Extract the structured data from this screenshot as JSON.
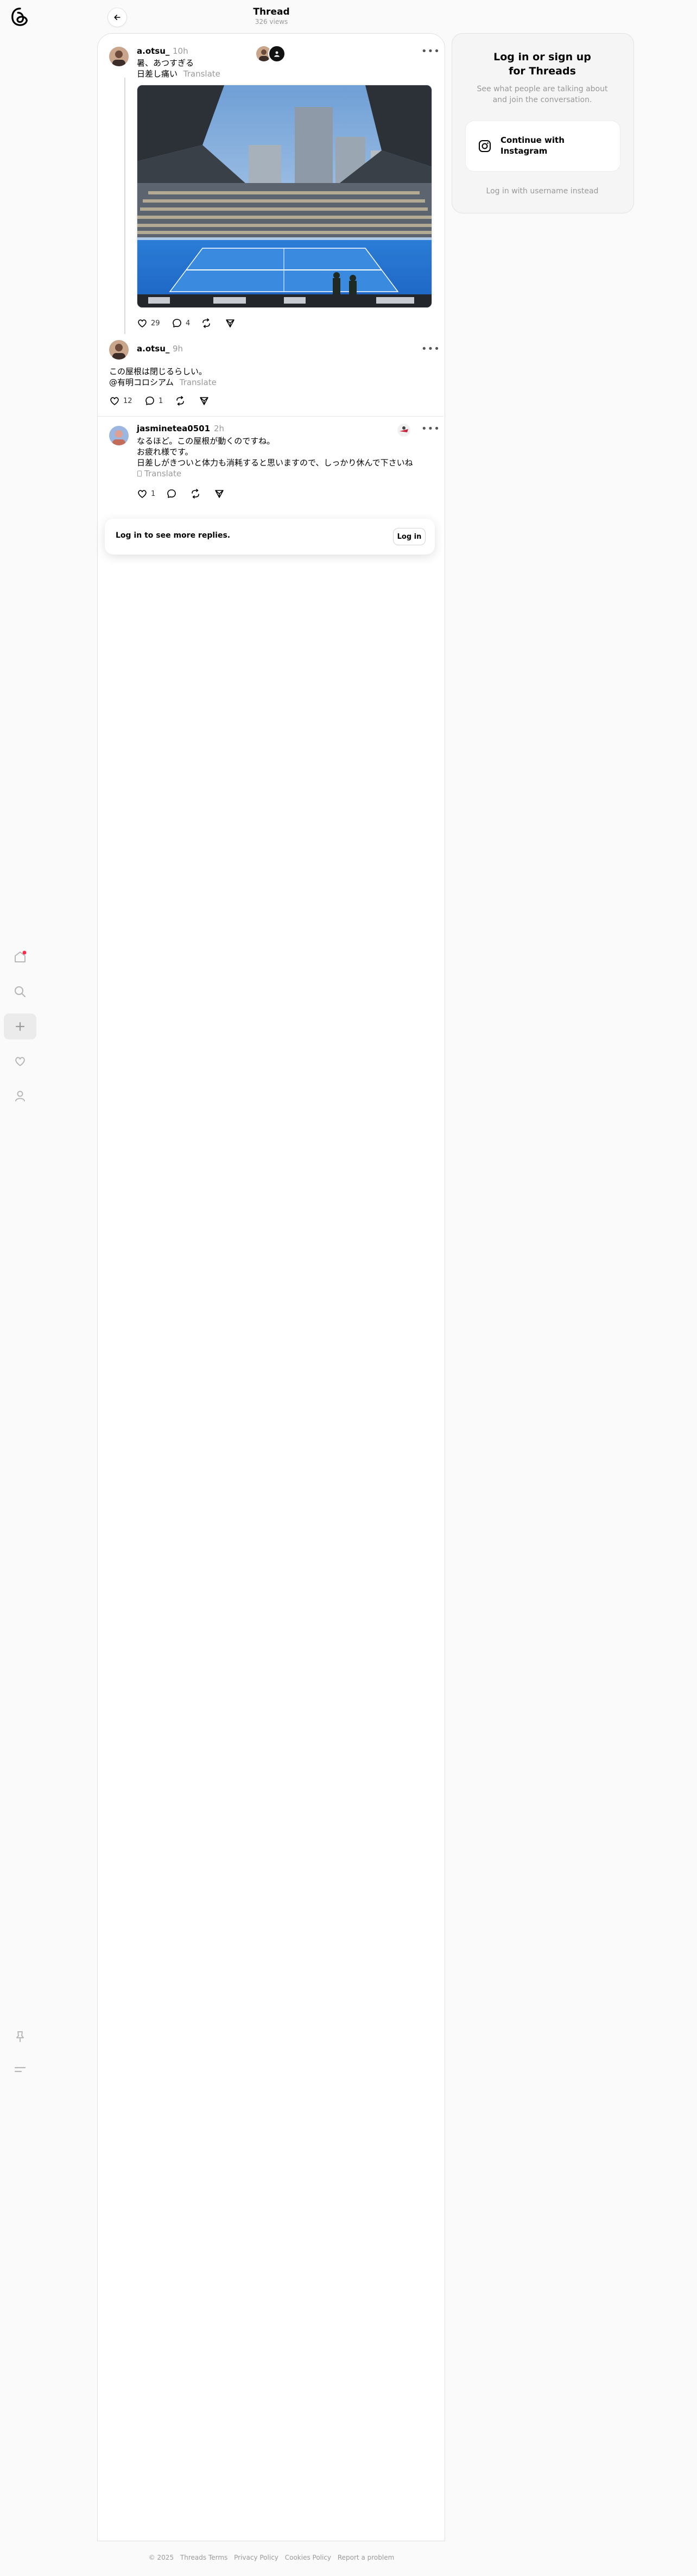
{
  "header": {
    "title": "Thread",
    "views": "326 views"
  },
  "nav": {
    "logo_icon": "threads-logo-icon",
    "items": [
      "home-icon",
      "search-icon",
      "create-icon",
      "activity-icon",
      "profile-icon"
    ],
    "bottom": [
      "pin-icon",
      "menu-icon"
    ]
  },
  "posts": [
    {
      "username": "a.otsu_",
      "time": "10h",
      "lines": [
        "暑、あつすぎる",
        "日差し痛い"
      ],
      "translate": "Translate",
      "likes": "29",
      "replies": "4",
      "has_image": true
    },
    {
      "username": "a.otsu_",
      "time": "9h",
      "lines": [
        "この屋根は閉じるらしい。",
        "@有明コロシアム"
      ],
      "translate": "Translate",
      "likes": "12",
      "replies": "1"
    },
    {
      "username": "jasminetea0501",
      "time": "2h",
      "lines": [
        "なるほど。この屋根が動くのですね。",
        "お疲れ様です。",
        "日差しがきついと体力も消耗すると思いますので、しっかり休んで下さいね"
      ],
      "translate": "Translate",
      "likes": "1",
      "replies": ""
    }
  ],
  "login_bar": {
    "text": "Log in to see more replies.",
    "button": "Log in"
  },
  "side": {
    "title_line1": "Log in or sign up",
    "title_line2": "for Threads",
    "sub_line1": "See what people are talking about",
    "sub_line2": "and join the conversation.",
    "instagram_line1": "Continue with",
    "instagram_line2": "Instagram",
    "alt_login": "Log in with username instead"
  },
  "footer": [
    "© 2025",
    "Threads Terms",
    "Privacy Policy",
    "Cookies Policy",
    "Report a problem"
  ]
}
